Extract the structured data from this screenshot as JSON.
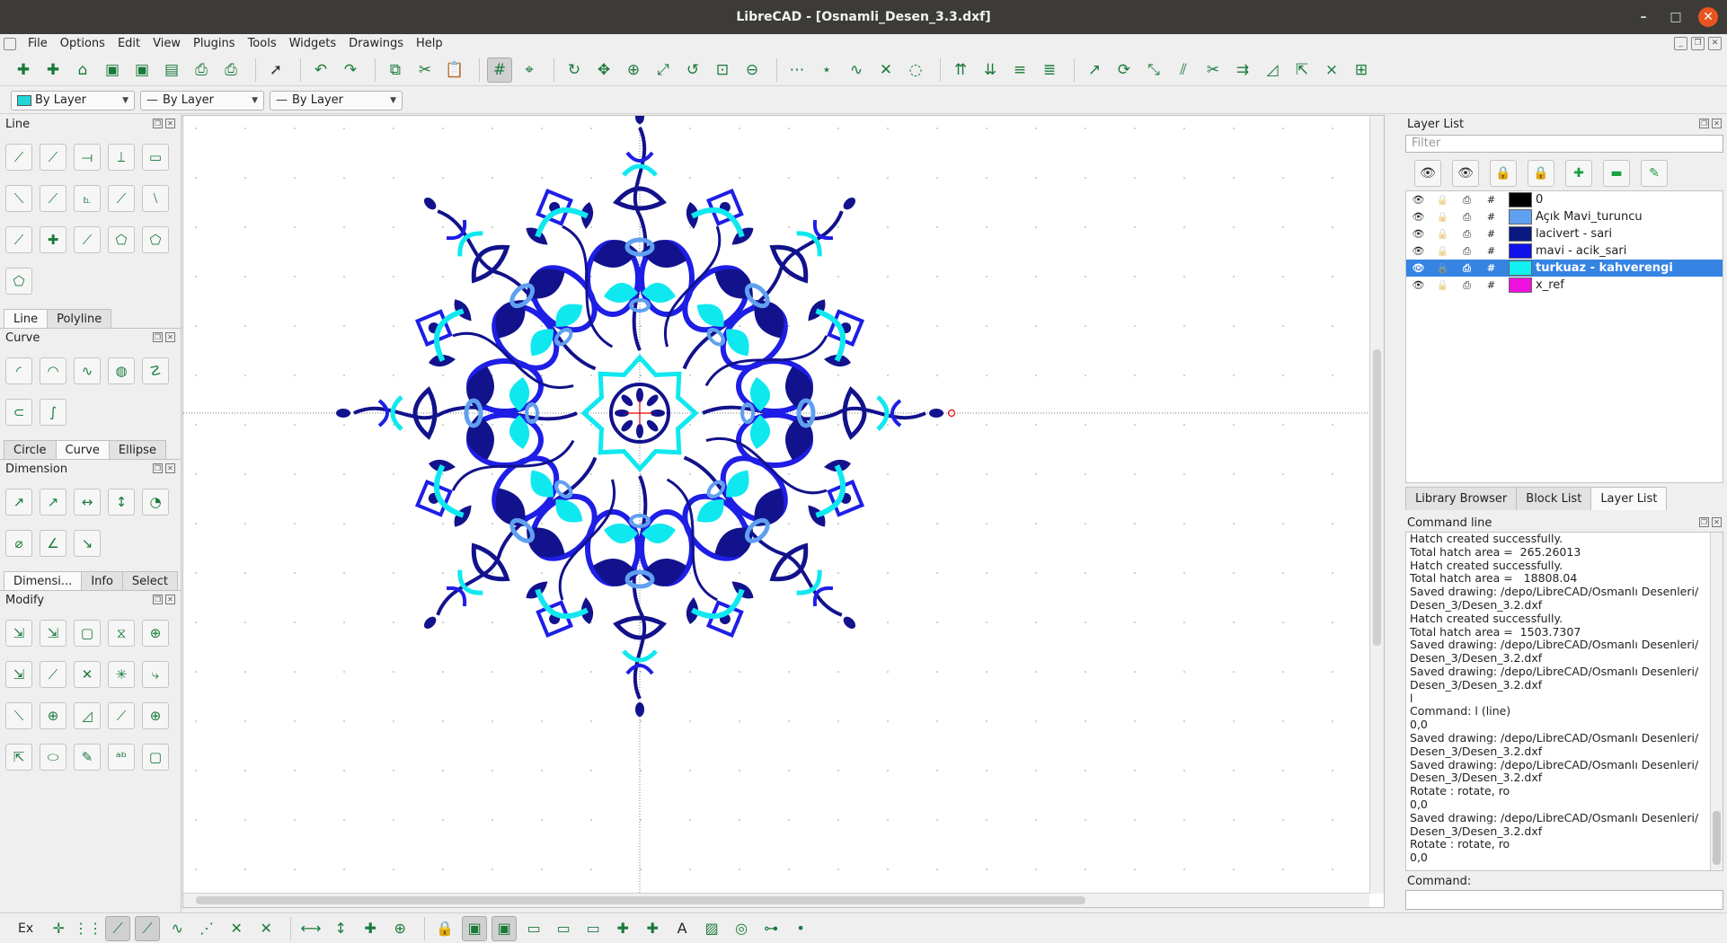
{
  "window": {
    "title": "LibreCAD - [Osnamli_Desen_3.3.dxf]",
    "controls": [
      "–",
      "□",
      "✕"
    ]
  },
  "menu": [
    "File",
    "Options",
    "Edit",
    "View",
    "Plugins",
    "Tools",
    "Widgets",
    "Drawings",
    "Help"
  ],
  "toolbar": {
    "groups": [
      [
        "new-icon",
        "new-template-icon",
        "open-icon",
        "save-icon",
        "save-as-icon",
        "save-all-icon",
        "print-icon",
        "print-preview-icon"
      ],
      [
        "select-pointer-icon"
      ],
      [
        "undo-icon",
        "redo-icon"
      ],
      [
        "copy-icon",
        "cut-icon",
        "paste-icon"
      ],
      [
        "grid-icon",
        "draft-icon"
      ],
      [
        "zoom-redraw-icon",
        "zoom-pan-icon",
        "zoom-in-icon",
        "zoom-auto-icon",
        "zoom-previous-icon",
        "zoom-window-icon",
        "zoom-out-icon"
      ],
      [
        "snap-endpoint-icon",
        "snap-middle-icon",
        "snap-distance-icon",
        "snap-intersection-icon",
        "snap-free-icon"
      ],
      [
        "order-top-icon",
        "order-bottom-icon",
        "order-raise-icon",
        "order-lower-icon"
      ],
      [
        "move-icon",
        "rotate-icon",
        "scale-icon",
        "mirror-icon",
        "trim-icon",
        "offset-icon",
        "bevel-icon",
        "stretch-icon",
        "explode-icon",
        "divide-icon"
      ]
    ],
    "glyphs": [
      "✚",
      "✚",
      "⌂",
      "▣",
      "▣",
      "▤",
      "⎙",
      "⎙",
      "➚",
      "↶",
      "↷",
      "⧉",
      "✂",
      "📋",
      "#",
      "⌖",
      "↻",
      "✥",
      "⊕",
      "⤢",
      "↺",
      "⊡",
      "⊖",
      "⋯",
      "⋆",
      "∿",
      "✕",
      "◌",
      "⇈",
      "⇊",
      "≡",
      "≣",
      "↗",
      "⟳",
      "⤡",
      "⫽",
      "✂",
      "⇉",
      "◿",
      "⇱",
      "⨯",
      "⊞"
    ]
  },
  "properties": {
    "color": "By Layer",
    "linetype": "By Layer",
    "linewidth": "By Layer"
  },
  "left_docks": [
    {
      "title": "Line",
      "tools": [
        "line-2points-icon",
        "line-angle-icon",
        "line-horizontal-icon",
        "line-vertical-icon",
        "rectangle-icon",
        "line-bisector-icon",
        "line-tangent-icon",
        "line-orthogonal-icon",
        "line-relative-angle-icon",
        "line-parallel-icon",
        "line-freehand-icon",
        "line-perpendicular-icon",
        "line-snap-icon",
        "polygon-center-icon",
        "polygon-corner-icon",
        "polygon-icon"
      ],
      "tabs": [
        "Line",
        "Polyline"
      ],
      "active_tab": 0
    },
    {
      "title": "Curve",
      "tools": [
        "arc-center-icon",
        "arc-3points-icon",
        "arc-tangent-icon",
        "ellipse-arc-icon",
        "spline-icon",
        "spline-points-icon",
        "freehand-curve-icon"
      ],
      "tabs": [
        "Circle",
        "Curve",
        "Ellipse"
      ],
      "active_tab": 1
    },
    {
      "title": "Dimension",
      "tools": [
        "dim-aligned-icon",
        "dim-linear-icon",
        "dim-horizontal-icon",
        "dim-vertical-icon",
        "dim-radial-icon",
        "dim-diameter-icon",
        "dim-angular-icon",
        "dim-leader-icon"
      ],
      "tabs": [
        "Dimensi...",
        "Info",
        "Select"
      ],
      "active_tab": 0
    },
    {
      "title": "Modify",
      "tools": [
        "move-copy-icon",
        "rotate-icon",
        "scale-icon",
        "mirror-icon",
        "move-rotate-icon",
        "rotate2-icon",
        "trim-icon",
        "trim2-icon",
        "lengthen-icon",
        "offset-icon",
        "bevel-icon",
        "fillet-icon",
        "divide-icon",
        "stretch-icon",
        "properties-icon",
        "attributes-icon",
        "explode-text-icon",
        "explode-icon",
        "delete-icon",
        "revert-icon"
      ]
    }
  ],
  "tool_glyphs": [
    "⟋",
    "⟋",
    "⟞",
    "⟘",
    "▭",
    "⟍",
    "⟋",
    "⦜",
    "⟋",
    "⧵",
    "⟋",
    "✚",
    "⟋",
    "⬠",
    "⬠",
    "⬠",
    "◜",
    "◠",
    "∿",
    "◍",
    "☡",
    "⊂",
    "∫",
    "↗",
    "↗",
    "↔",
    "↕",
    "◔",
    "⌀",
    "∠",
    "↘",
    "⇲",
    "⇲",
    "▢",
    "⧖",
    "⊕",
    "⇲",
    "⟋",
    "✕",
    "✳",
    "⤷",
    "⟍",
    "⊕",
    "◿",
    "⟋",
    "⊕",
    "⇱",
    "⬭",
    "✎",
    "ᵃᵇ",
    "▢",
    "⊠"
  ],
  "layer_list": {
    "title": "Layer List",
    "filter_placeholder": "Filter",
    "buttons": [
      "show-all-icon",
      "hide-all-icon",
      "unlock-all-icon",
      "lock-all-icon",
      "add-layer-icon",
      "remove-layer-icon",
      "edit-layer-icon"
    ],
    "button_glyphs": [
      "👁",
      "👁",
      "🔒",
      "🔒",
      "✚",
      "▬",
      "✎"
    ],
    "layers": [
      {
        "name": "0",
        "color": "#000000",
        "selected": false
      },
      {
        "name": "Açık Mavi_turuncu",
        "color": "#5fa0f0",
        "selected": false
      },
      {
        "name": "lacivert - sari",
        "color": "#0a1a80",
        "selected": false
      },
      {
        "name": "mavi - acik_sari",
        "color": "#1010e8",
        "selected": false
      },
      {
        "name": "turkuaz - kahverengi",
        "color": "#10f0f0",
        "selected": true
      },
      {
        "name": "x_ref",
        "color": "#f010e0",
        "selected": false
      }
    ]
  },
  "right_tabs": [
    "Library Browser",
    "Block List",
    "Layer List"
  ],
  "right_active_tab": 2,
  "command_line": {
    "title": "Command line",
    "log": [
      "Hatch created successfully.",
      "Total hatch area =  265.26013",
      "Hatch created successfully.",
      "Total hatch area =   18808.04",
      "Saved drawing: /depo/LibreCAD/Osmanlı Desenleri/",
      "Desen_3/Desen_3.2.dxf",
      "Hatch created successfully.",
      "Total hatch area =  1503.7307",
      "Saved drawing: /depo/LibreCAD/Osmanlı Desenleri/",
      "Desen_3/Desen_3.2.dxf",
      "Saved drawing: /depo/LibreCAD/Osmanlı Desenleri/",
      "Desen_3/Desen_3.2.dxf",
      "l",
      "Command: l (line)",
      "0,0",
      "Saved drawing: /depo/LibreCAD/Osmanlı Desenleri/",
      "Desen_3/Desen_3.2.dxf",
      "Saved drawing: /depo/LibreCAD/Osmanlı Desenleri/",
      "Desen_3/Desen_3.2.dxf",
      "Rotate : rotate, ro",
      "0,0",
      "Saved drawing: /depo/LibreCAD/Osmanlı Desenleri/",
      "Desen_3/Desen_3.2.dxf",
      "Rotate : rotate, ro",
      "0,0"
    ],
    "input_label": "Command:"
  },
  "statusbar": {
    "label": "Ex",
    "snap_tools": [
      "snap-free-icon",
      "snap-grid-icon",
      "snap-endpoint-icon",
      "snap-entity-icon",
      "snap-center-icon",
      "snap-middle-icon",
      "snap-distance-icon",
      "snap-intersection-icon",
      "restrict-horizontal-icon",
      "restrict-vertical-icon",
      "restrict-orthogonal-icon",
      "relative-zero-icon",
      "lock-relative-zero-icon",
      "view-icon",
      "view2-icon",
      "view3-icon",
      "view4-icon",
      "view5-icon",
      "block-add-icon",
      "block-insert-icon",
      "text-icon",
      "hatch-icon",
      "camera-icon",
      "link-icon",
      "dot-icon"
    ],
    "glyphs": [
      "✛",
      "⋮⋮",
      "⟋",
      "⟋",
      "∿",
      "⋰",
      "✕",
      "✕",
      "⟷",
      "↕",
      "✚",
      "⊕",
      "🔒",
      "▣",
      "▣",
      "▭",
      "▭",
      "▭",
      "✚",
      "✚",
      "A",
      "▨",
      "◎",
      "⊶",
      "•"
    ]
  },
  "colors": {
    "navy": "#12128c",
    "blue": "#1e1ee6",
    "light_blue": "#5fa0f0",
    "cyan": "#10e8f0",
    "crosshair": "#e00000"
  }
}
